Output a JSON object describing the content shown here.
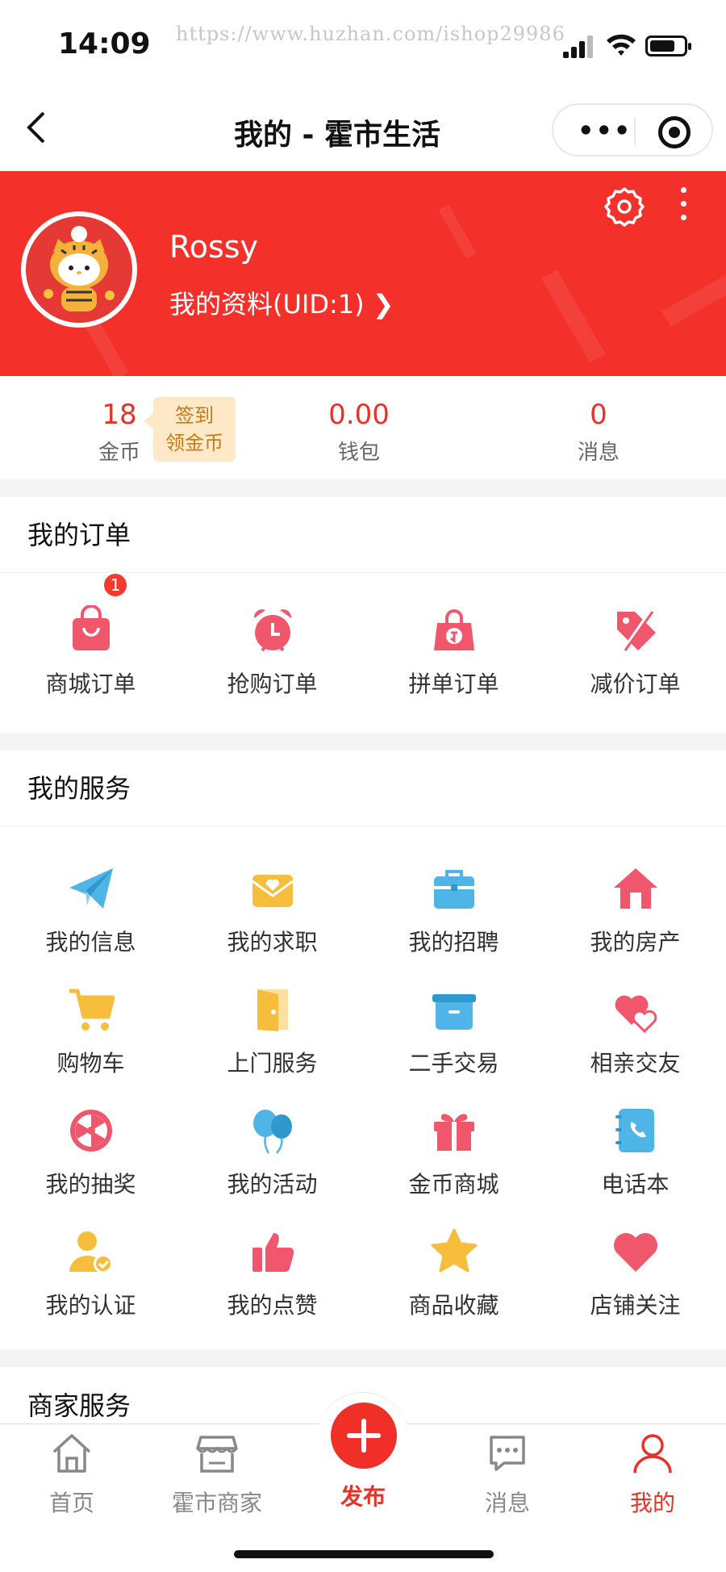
{
  "status": {
    "time": "14:09",
    "watermark": "https://www.huzhan.com/ishop29986"
  },
  "nav": {
    "title": "我的 - 霍市生活"
  },
  "profile": {
    "name": "Rossy",
    "link": "我的资料(UID:1) ❯"
  },
  "stats": {
    "coins": {
      "value": "18",
      "label": "金币"
    },
    "signin": [
      "签到",
      "领金币"
    ],
    "wallet": {
      "value": "0.00",
      "label": "钱包"
    },
    "messages": {
      "value": "0",
      "label": "消息"
    }
  },
  "orders": {
    "title": "我的订单",
    "items": [
      {
        "label": "商城订单",
        "icon": "shopping-bag-icon",
        "badge": "1"
      },
      {
        "label": "抢购订单",
        "icon": "alarm-clock-icon"
      },
      {
        "label": "拼单订单",
        "icon": "group-bag-icon"
      },
      {
        "label": "减价订单",
        "icon": "discount-tag-icon"
      }
    ]
  },
  "services": {
    "title": "我的服务",
    "items": [
      {
        "label": "我的信息",
        "icon": "paper-plane-icon"
      },
      {
        "label": "我的求职",
        "icon": "envelope-heart-icon"
      },
      {
        "label": "我的招聘",
        "icon": "briefcase-icon"
      },
      {
        "label": "我的房产",
        "icon": "house-icon"
      },
      {
        "label": "购物车",
        "icon": "cart-icon"
      },
      {
        "label": "上门服务",
        "icon": "door-icon"
      },
      {
        "label": "二手交易",
        "icon": "box-icon"
      },
      {
        "label": "相亲交友",
        "icon": "hearts-icon"
      },
      {
        "label": "我的抽奖",
        "icon": "lottery-wheel-icon"
      },
      {
        "label": "我的活动",
        "icon": "balloons-icon"
      },
      {
        "label": "金币商城",
        "icon": "gift-icon"
      },
      {
        "label": "电话本",
        "icon": "phonebook-icon"
      },
      {
        "label": "我的认证",
        "icon": "verified-user-icon"
      },
      {
        "label": "我的点赞",
        "icon": "thumbs-up-icon"
      },
      {
        "label": "商品收藏",
        "icon": "star-icon"
      },
      {
        "label": "店铺关注",
        "icon": "heart-icon"
      }
    ]
  },
  "merchant": {
    "title": "商家服务"
  },
  "tabs": [
    {
      "label": "首页",
      "icon": "home-icon"
    },
    {
      "label": "霍市商家",
      "icon": "store-icon"
    },
    {
      "label": "发布",
      "icon": "plus-icon"
    },
    {
      "label": "消息",
      "icon": "chat-icon"
    },
    {
      "label": "我的",
      "icon": "user-icon"
    }
  ],
  "colors": {
    "primary": "#f4302a",
    "accent_text": "#e63228",
    "pink": "#f0566c",
    "blue": "#4fb5e6",
    "yellow": "#f7bd3c"
  }
}
